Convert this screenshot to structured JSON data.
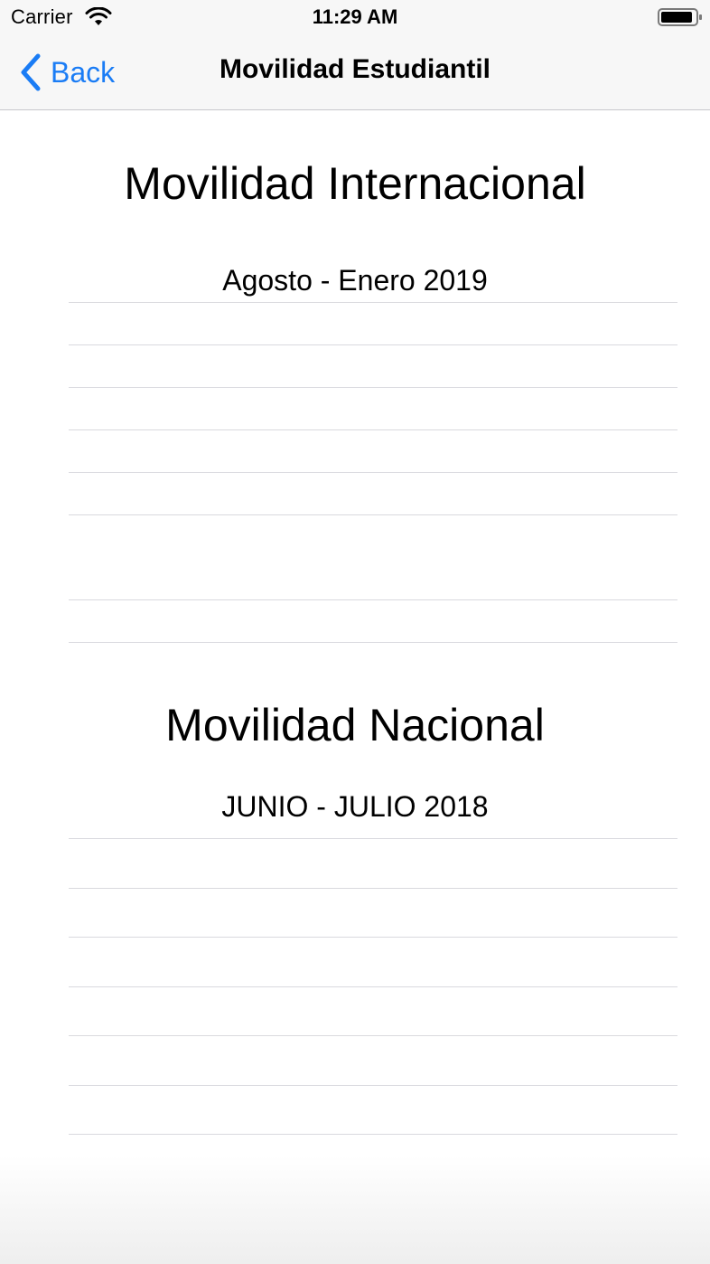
{
  "status_bar": {
    "carrier": "Carrier",
    "time": "11:29 AM",
    "icons": [
      "wifi-icon",
      "battery-icon"
    ]
  },
  "nav_bar": {
    "back_label": "Back",
    "title": "Movilidad Estudiantil",
    "accent_color": "#1a7cf5"
  },
  "sections": [
    {
      "title": "Movilidad Internacional",
      "subtitle": "Agosto - Enero 2019"
    },
    {
      "title": "Movilidad Nacional",
      "subtitle": "JUNIO - JULIO 2018"
    }
  ]
}
